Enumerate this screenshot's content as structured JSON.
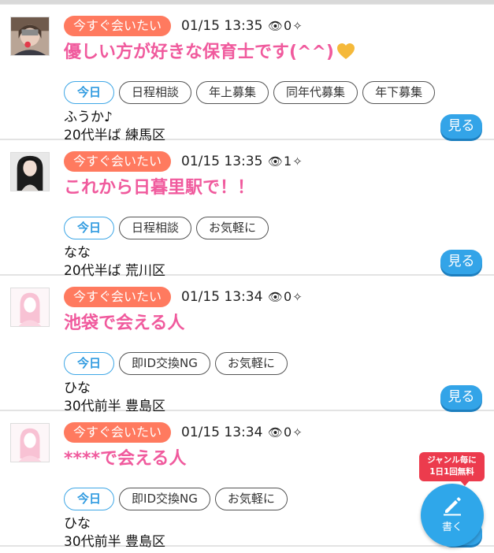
{
  "posts": [
    {
      "tag": "今すぐ会いたい",
      "time": "01/15 13:35",
      "views": "0",
      "title": "優しい方が好きな保育士です(^^)",
      "heart": true,
      "chips": [
        "今日",
        "日程相談",
        "年上募集",
        "同年代募集",
        "年下募集"
      ],
      "name": "ふうか♪",
      "meta": "20代半ば 練馬区",
      "button": "見る",
      "avatar": "photo-1"
    },
    {
      "tag": "今すぐ会いたい",
      "time": "01/15 13:35",
      "views": "1",
      "title": "これから日暮里駅で！！",
      "heart": false,
      "chips": [
        "今日",
        "日程相談",
        "お気軽に"
      ],
      "name": "なな",
      "meta": "20代半ば 荒川区",
      "button": "見る",
      "avatar": "photo-2"
    },
    {
      "tag": "今すぐ会いたい",
      "time": "01/15 13:34",
      "views": "0",
      "title": "池袋で会える人",
      "heart": false,
      "chips": [
        "今日",
        "即ID交換NG",
        "お気軽に"
      ],
      "name": "ひな",
      "meta": "30代前半 豊島区",
      "button": "見る",
      "avatar": "placeholder"
    },
    {
      "tag": "今すぐ会いたい",
      "time": "01/15 13:34",
      "views": "0",
      "title": "****で会える人",
      "heart": false,
      "chips": [
        "今日",
        "即ID交換NG",
        "お気軽に"
      ],
      "name": "ひな",
      "meta": "30代前半 豊島区",
      "button": "見る",
      "avatar": "placeholder"
    }
  ],
  "promo": {
    "line1": "ジャンル毎に",
    "line2": "1日1回無料"
  },
  "write_button": {
    "label": "書く"
  },
  "colors": {
    "tag_bg": "#ff7a5f",
    "title": "#f05a9d",
    "accent_blue": "#33a4e8",
    "promo_red": "#ec3b4d"
  },
  "icons": {
    "views": "eye-icon",
    "sparkle": "sparkle-icon",
    "heart": "heart-icon",
    "write": "pen-icon"
  }
}
